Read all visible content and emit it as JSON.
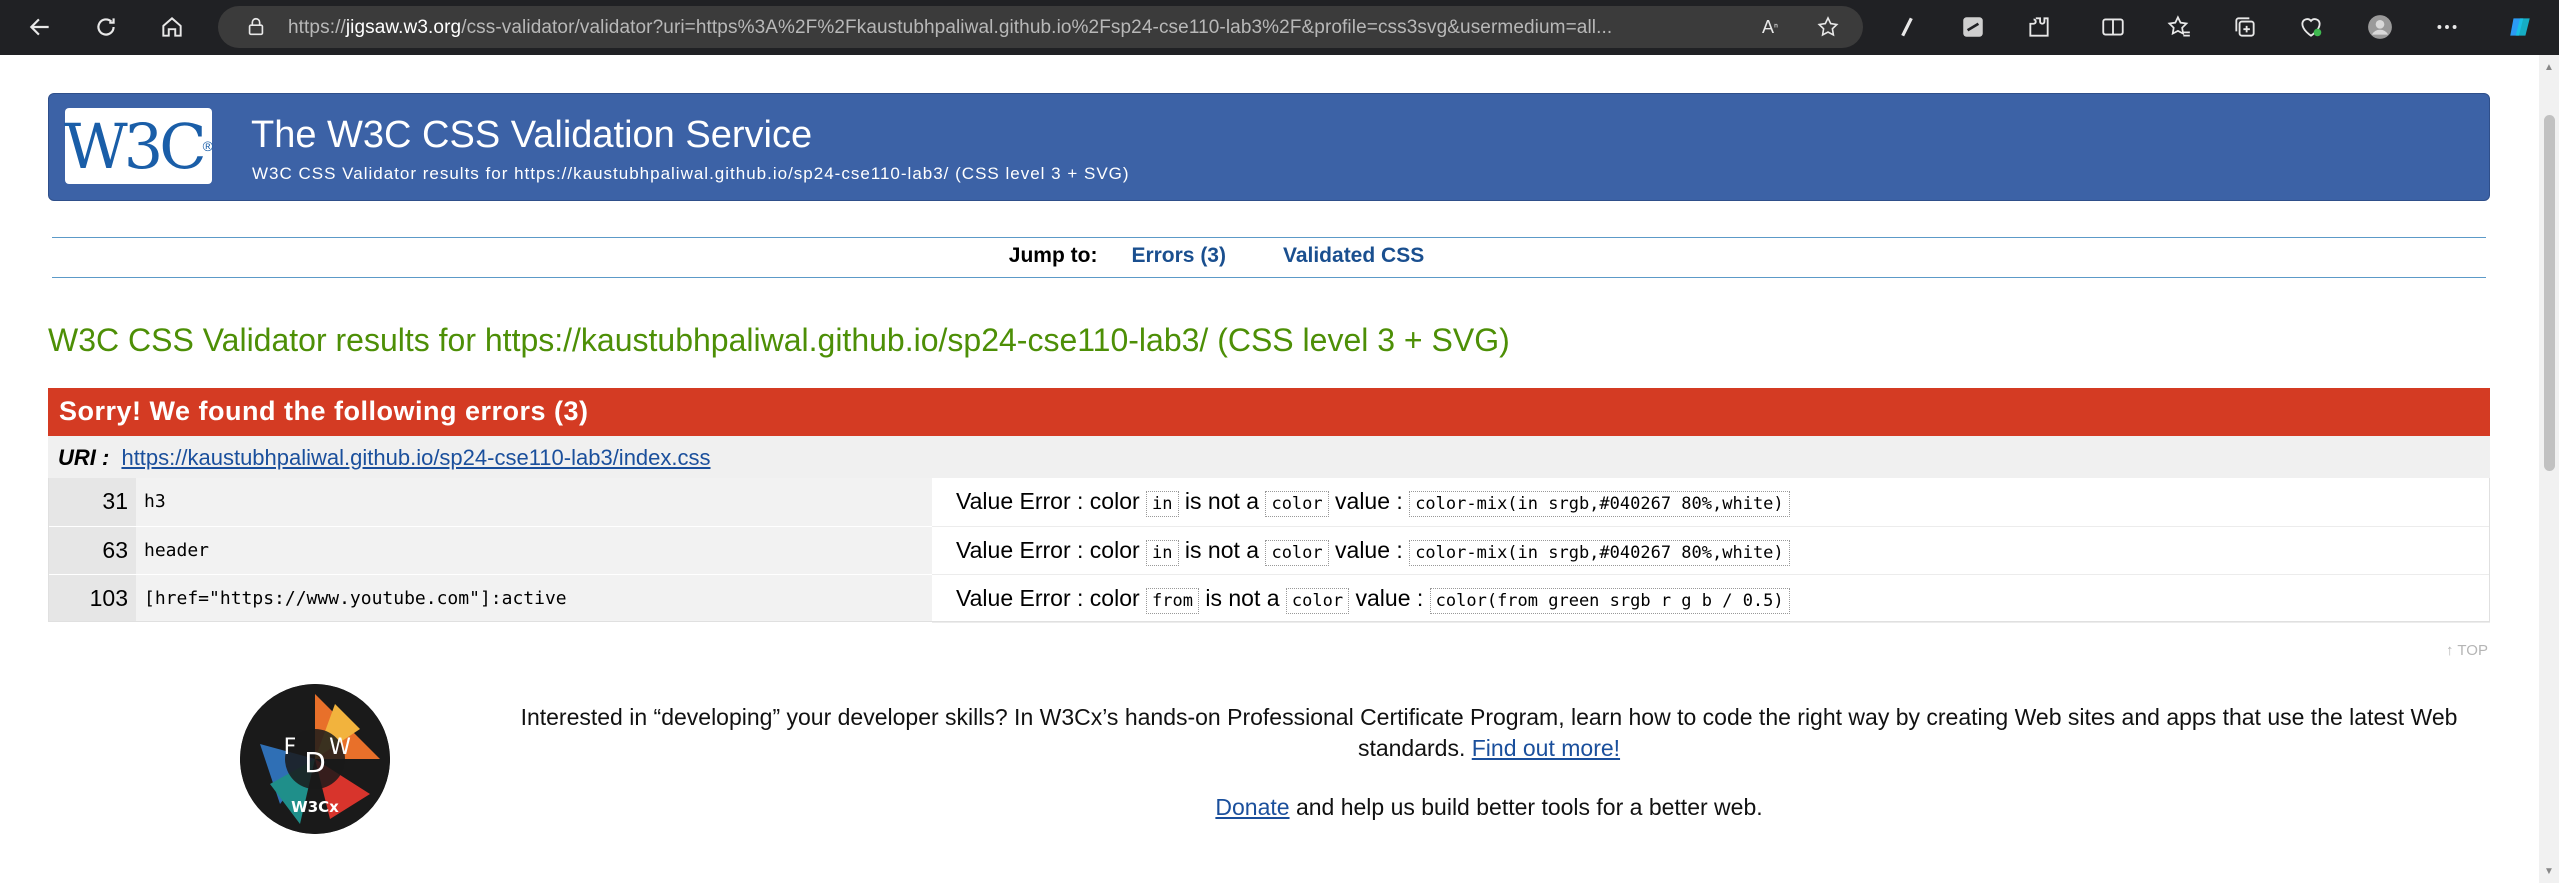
{
  "browser": {
    "url_domain": "jigsaw.w3.org",
    "url_prefix": "https://",
    "url_rest": "/css-validator/validator?uri=https%3A%2F%2Fkaustubhpaliwal.github.io%2Fsp24-cse110-lab3%2F&profile=css3svg&usermedium=all...",
    "icons": [
      "back-icon",
      "refresh-icon",
      "home-icon",
      "lock-icon",
      "read-aloud-icon",
      "favorite-star-icon",
      "extension-a-icon",
      "extension-b-icon",
      "extensions-icon",
      "split-screen-icon",
      "favorites-icon",
      "collections-icon",
      "browser-essentials-icon",
      "profile-icon",
      "more-icon",
      "copilot-icon"
    ]
  },
  "banner": {
    "logo": "W3C",
    "title": "The W3C CSS Validation Service",
    "subtitle": "W3C CSS Validator results for https://kaustubhpaliwal.github.io/sp24-cse110-lab3/ (CSS level 3 + SVG)"
  },
  "jump": {
    "label": "Jump to:",
    "errors_link": "Errors (3)",
    "validated_link": "Validated CSS"
  },
  "results_title": "W3C CSS Validator results for https://kaustubhpaliwal.github.io/sp24-cse110-lab3/ (CSS level 3 + SVG)",
  "errors": {
    "heading": "Sorry! We found the following errors (3)",
    "uri_label": "URI :",
    "uri": "https://kaustubhpaliwal.github.io/sp24-cse110-lab3/index.css",
    "rows": [
      {
        "line": "31",
        "context": "h3",
        "msg_prefix": "Value Error : color",
        "bad": "in",
        "mid": "is not a",
        "type": "color",
        "value_label": "value :",
        "value": "color-mix(in srgb,#040267 80%,white)"
      },
      {
        "line": "63",
        "context": "header",
        "msg_prefix": "Value Error : color",
        "bad": "in",
        "mid": "is not a",
        "type": "color",
        "value_label": "value :",
        "value": "color-mix(in srgb,#040267 80%,white)"
      },
      {
        "line": "103",
        "context": "[href=\"https://www.youtube.com\"]:active",
        "msg_prefix": "Value Error : color",
        "bad": "from",
        "mid": "is not a",
        "type": "color",
        "value_label": "value :",
        "value": "color(from green srgb r g b / 0.5)"
      }
    ]
  },
  "top_link": "↑ TOP",
  "promo": {
    "text": "Interested in “developing” your developer skills? In W3Cx’s hands-on Professional Certificate Program, learn how to code the right way by creating Web sites and apps that use the latest Web standards.",
    "link": "Find out more!",
    "badge_text": "W3Cx"
  },
  "donate": {
    "link": "Donate",
    "text": "and help us build better tools for a better web."
  },
  "colors": {
    "banner": "#3c62a6",
    "error_header": "#d43b23",
    "results_title": "#4d8f06",
    "link": "#1a4f9c"
  }
}
